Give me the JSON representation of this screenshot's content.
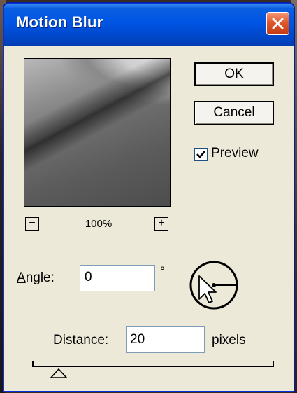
{
  "dialog": {
    "title": "Motion Blur",
    "close_icon": "close-x-icon"
  },
  "preview": {
    "zoom_out_label": "−",
    "zoom_in_label": "+",
    "zoom_level": "100%"
  },
  "buttons": {
    "ok_label": "OK",
    "cancel_label": "Cancel"
  },
  "preview_toggle": {
    "checked": true,
    "label_mnemonic": "P",
    "label_rest": "review"
  },
  "angle": {
    "label_mnemonic": "A",
    "label_rest": "ngle:",
    "value": "0",
    "unit": "°"
  },
  "distance": {
    "label_mnemonic": "D",
    "label_rest": "istance:",
    "value": "20",
    "unit": "pixels"
  },
  "colors": {
    "titlebar": "#0055e5",
    "dialog_bg": "#ece9d8",
    "close_button": "#e0582c"
  }
}
